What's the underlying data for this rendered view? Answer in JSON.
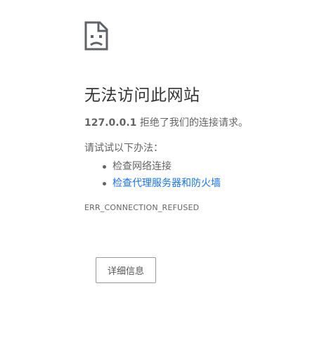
{
  "error_page": {
    "icon": "sad-page-icon",
    "title": "无法访问此网站",
    "summary": {
      "host": "127.0.0.1",
      "message": " 拒绝了我们的连接请求。"
    },
    "suggestions_heading": "请试试以下办法：",
    "suggestions": [
      {
        "label": "检查网络连接",
        "is_link": false
      },
      {
        "label": "检查代理服务器和防火墙",
        "is_link": true
      }
    ],
    "error_code": "ERR_CONNECTION_REFUSED",
    "details_button_label": "详细信息"
  },
  "colors": {
    "text": "#646464",
    "title": "#333333",
    "link": "#1a73e8",
    "button_border": "#9a9a9a"
  }
}
